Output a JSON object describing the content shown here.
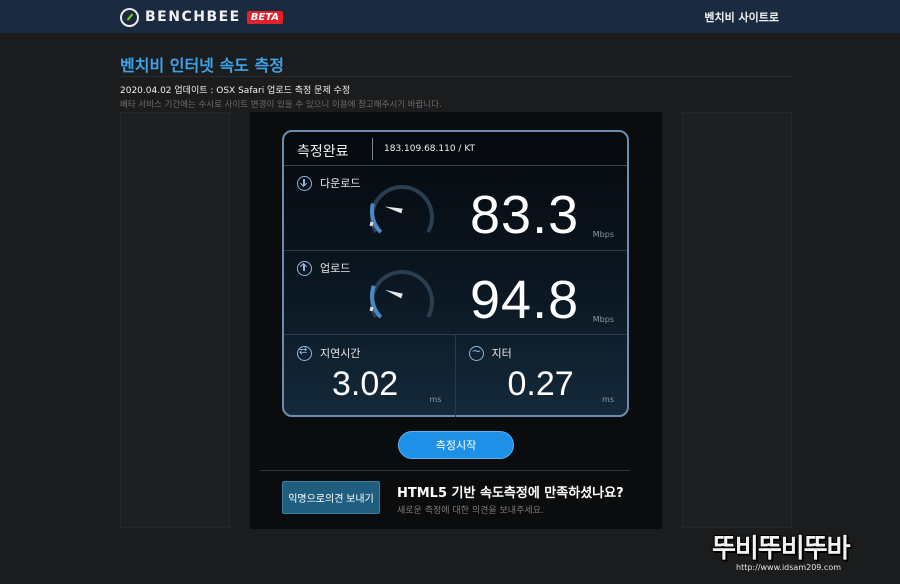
{
  "header": {
    "brand": "BENCHBEE",
    "badge": "BETA",
    "site_link": "벤치비 사이트로"
  },
  "page": {
    "title": "벤치비 인터넷 속도 측정",
    "update": "2020.04.02 업데이트 : OSX Safari 업로드 측정 문제 수정",
    "notice": "베타 서비스 기간에는 수시로 사이트 변경이 있을 수 있으니 이용에 참고해주시기 바랍니다."
  },
  "result": {
    "status": "측정완료",
    "ip_isp": "183.109.68.110 / KT",
    "download": {
      "label": "다운로드",
      "value": "83.3",
      "unit": "Mbps",
      "gauge_fraction": 0.22
    },
    "upload": {
      "label": "업로드",
      "value": "94.8",
      "unit": "Mbps",
      "gauge_fraction": 0.24
    },
    "latency": {
      "label": "지연시간",
      "value": "3.02",
      "unit": "ms"
    },
    "jitter": {
      "label": "지터",
      "value": "0.27",
      "unit": "ms"
    }
  },
  "actions": {
    "start": "측정시작",
    "feedback": "익명으로의견 보내기"
  },
  "feedback": {
    "title": "HTML5 기반 속도측정에 만족하셨나요?",
    "subtitle": "새로운 측정에 대한 의견을 보내주세요."
  },
  "watermark": {
    "logo": "뚜비뚜비뚜바",
    "url": "http://www.idsam209.com"
  },
  "colors": {
    "topbar": "#1a2a3f",
    "accent": "#3fa3ea",
    "button": "#1e90e8",
    "beta": "#e5202a"
  }
}
